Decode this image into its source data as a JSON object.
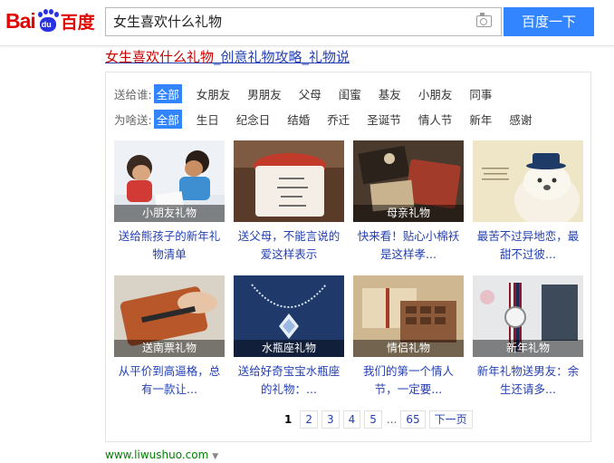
{
  "search": {
    "query": "女生喜欢什么礼物",
    "button_label": "百度一下"
  },
  "logo": {
    "left": "Bai",
    "right": "百度",
    "paw": "du"
  },
  "result": {
    "title_highlight": "女生喜欢什么礼物",
    "title_rest": "_创意礼物攻略_礼物说",
    "url": "www.liwushuo.com"
  },
  "filters": {
    "recipient": {
      "label": "送给谁:",
      "options": [
        "全部",
        "女朋友",
        "男朋友",
        "父母",
        "闺蜜",
        "基友",
        "小朋友",
        "同事"
      ]
    },
    "occasion": {
      "label": "为啥送:",
      "options": [
        "全部",
        "生日",
        "纪念日",
        "结婚",
        "乔迁",
        "圣诞节",
        "情人节",
        "新年",
        "感谢"
      ]
    }
  },
  "tiles": [
    {
      "caption": "小朋友礼物",
      "line1": "送给熊孩子的新年礼",
      "line2": "物清单"
    },
    {
      "caption": "",
      "line1": "送父母，不能言说的",
      "line2": "爱这样表示"
    },
    {
      "caption": "母亲礼物",
      "line1": "快来看！贴心小棉袄",
      "line2": "是这样孝..."
    },
    {
      "caption": "",
      "line1": "最苦不过异地恋，最",
      "line2": "甜不过彼..."
    },
    {
      "caption": "送南票礼物",
      "line1": "从平价到高逼格，总",
      "line2": "有一款让..."
    },
    {
      "caption": "水瓶座礼物",
      "line1": "送给好奇宝宝水瓶座",
      "line2": "的礼物：..."
    },
    {
      "caption": "情侣礼物",
      "line1": "我们的第一个情人",
      "line2": "节，一定要..."
    },
    {
      "caption": "新年礼物",
      "line1": "新年礼物送男友：余",
      "line2": "生还请多..."
    }
  ],
  "pager": {
    "current": "1",
    "pages": [
      "2",
      "3",
      "4",
      "5"
    ],
    "dots": "...",
    "last": "65",
    "next": "下一页"
  },
  "colors": {
    "accent": "#3385ff",
    "link": "#2440b3",
    "highlight": "#cc0000",
    "brand_red": "#e10601"
  }
}
